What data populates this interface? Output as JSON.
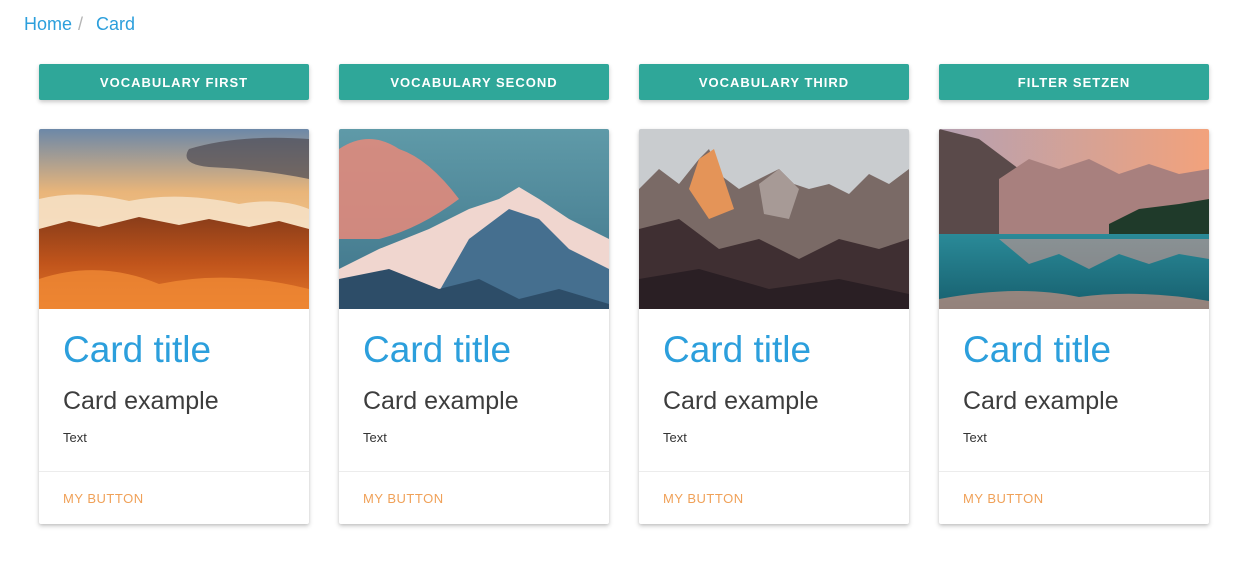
{
  "breadcrumb": {
    "items": [
      {
        "label": "Home"
      },
      {
        "label": "Card"
      }
    ],
    "separator": "/"
  },
  "actions": [
    {
      "label": "VOCABULARY FIRST"
    },
    {
      "label": "VOCABULARY SECOND"
    },
    {
      "label": "VOCABULARY THIRD"
    },
    {
      "label": "FILTER SETZEN"
    }
  ],
  "cards": [
    {
      "image": "sunset-mountain-clouds-photo",
      "title": "Card title",
      "subtitle": "Card example",
      "text": "Text",
      "button": "MY BUTTON"
    },
    {
      "image": "snowy-peak-pink-cloud-photo",
      "title": "Card title",
      "subtitle": "Card example",
      "text": "Text",
      "button": "MY BUTTON"
    },
    {
      "image": "jagged-mountain-range-photo",
      "title": "Card title",
      "subtitle": "Card example",
      "text": "Text",
      "button": "MY BUTTON"
    },
    {
      "image": "mountain-lake-reflection-photo",
      "title": "Card title",
      "subtitle": "Card example",
      "text": "Text",
      "button": "MY BUTTON"
    }
  ],
  "colors": {
    "accent_teal": "#2fa799",
    "link_blue": "#2c9fdc",
    "button_orange": "#f0a158",
    "text_dark": "#3d3d3d"
  }
}
